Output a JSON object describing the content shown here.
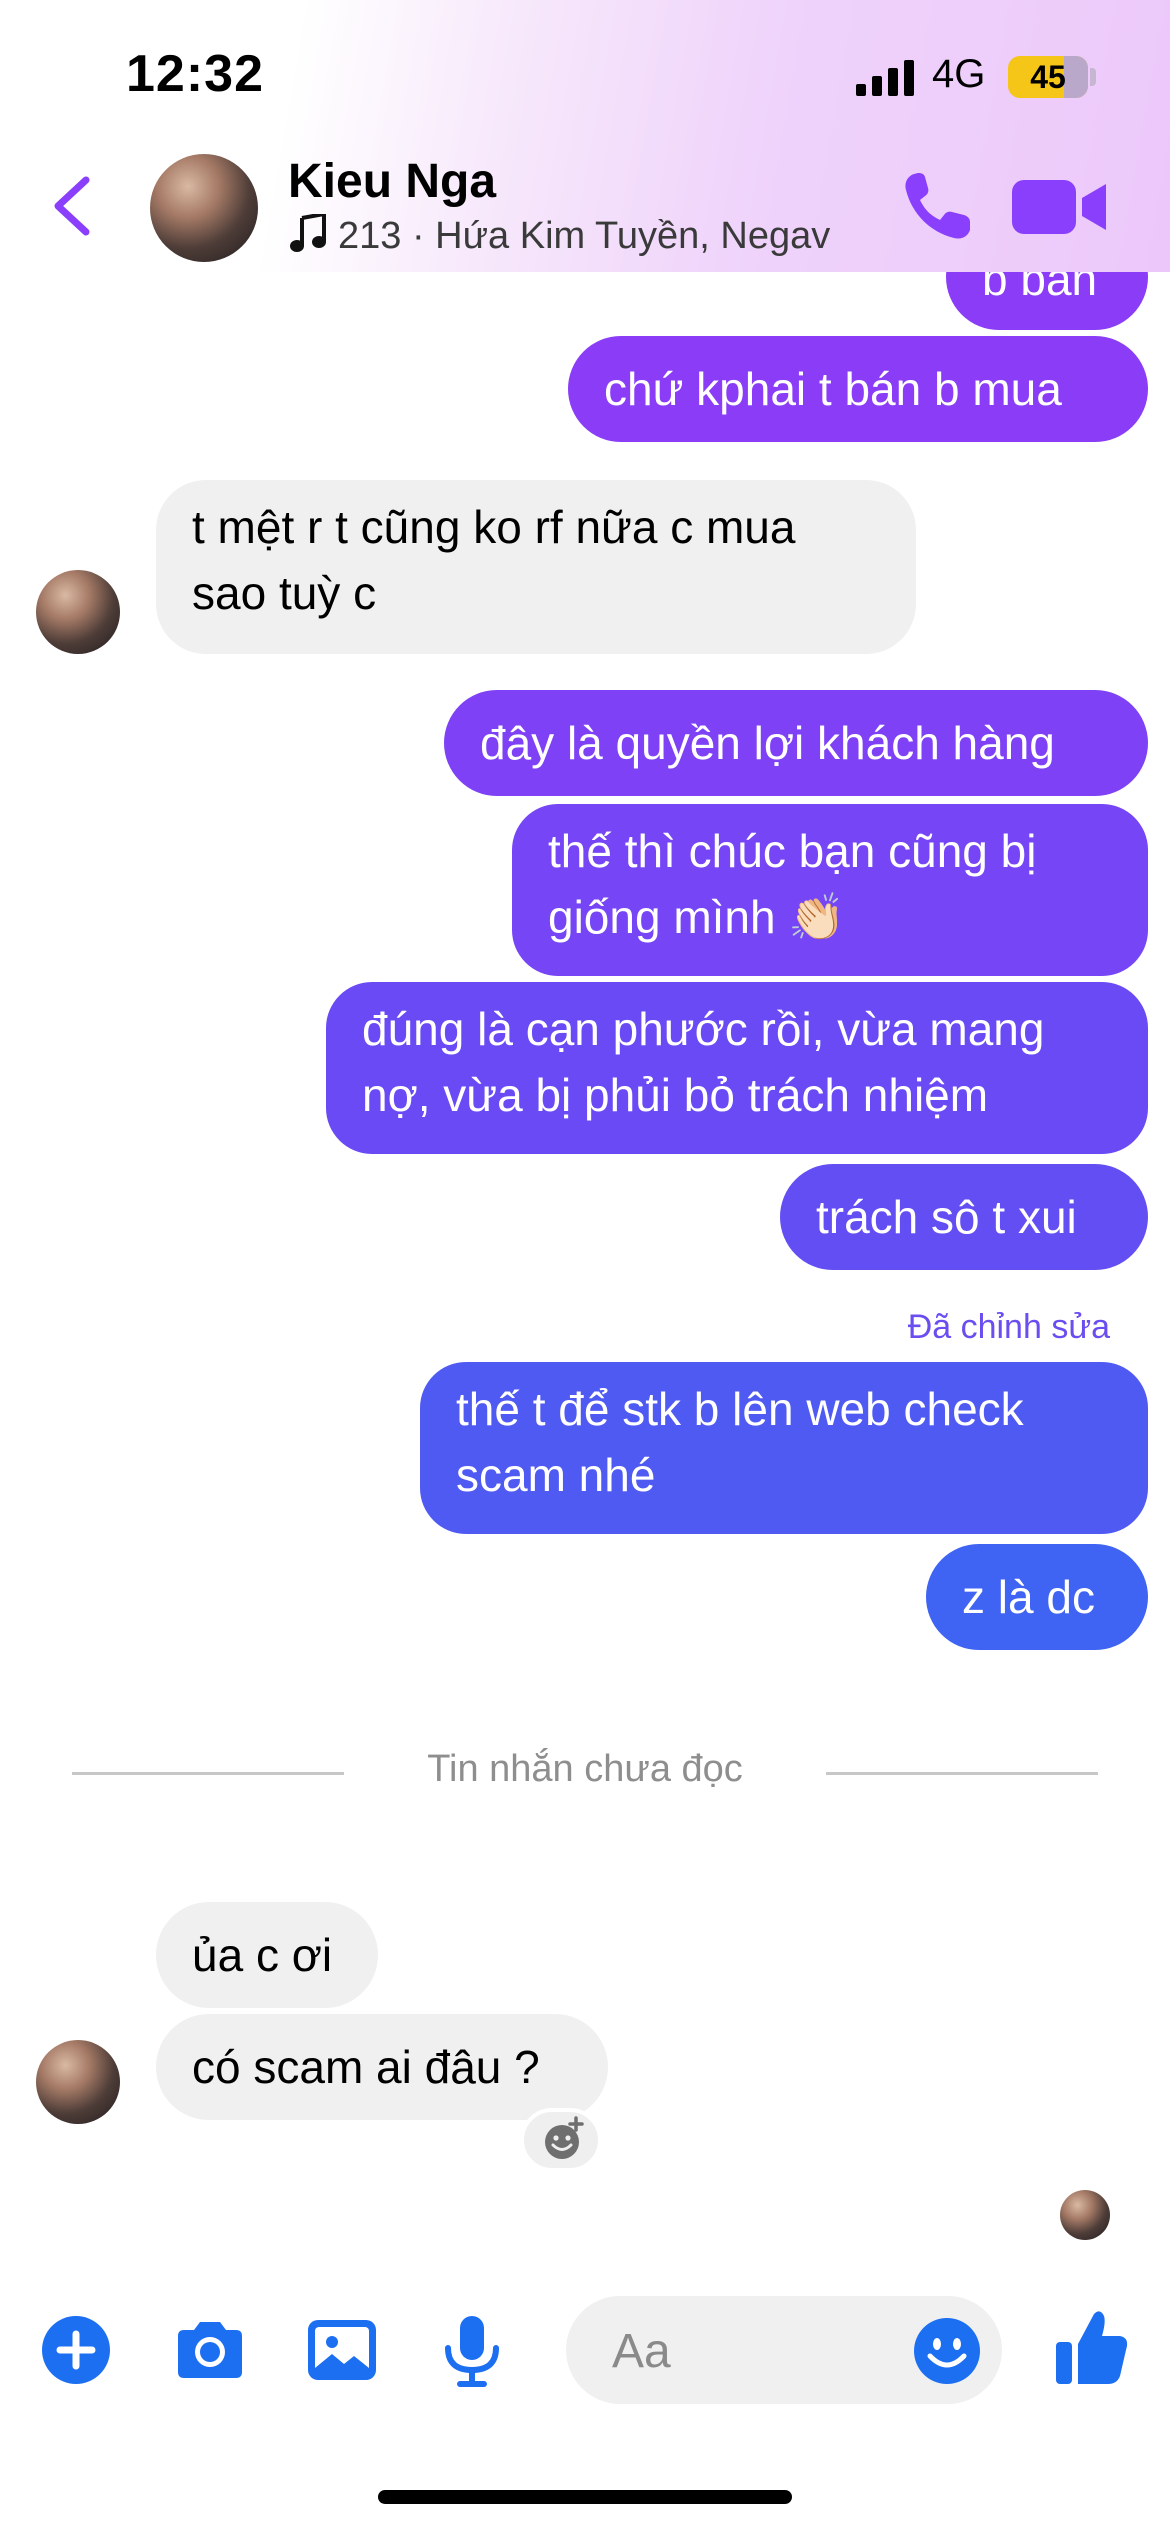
{
  "status_bar": {
    "time": "12:32",
    "network": "4G",
    "battery": "45"
  },
  "header": {
    "name": "Kieu Nga",
    "subtitle": "213 · Hứa Kim Tuyền, Negav"
  },
  "messages": [
    {
      "text": "b bán",
      "from": "me"
    },
    {
      "text": "chứ kphai t bán b mua",
      "from": "me"
    },
    {
      "lines": [
        "t mệt r t cũng ko rf nữa c mua",
        "sao tuỳ c"
      ],
      "from": "them"
    },
    {
      "text": "đây là quyền lợi khách hàng",
      "from": "me"
    },
    {
      "lines": [
        "thế thì chúc bạn cũng bị",
        "giống mình 👏🏻"
      ],
      "from": "me"
    },
    {
      "lines": [
        "đúng là cạn phước rồi, vừa mang",
        "nợ, vừa bị phủi bỏ trách nhiệm"
      ],
      "from": "me"
    },
    {
      "text": "trách sô t xui",
      "from": "me"
    },
    {
      "edited_label": "Đã chỉnh sửa",
      "lines": [
        "thế t để stk b lên web check",
        "scam nhé"
      ],
      "from": "me"
    },
    {
      "text": "z là dc",
      "from": "me"
    },
    {
      "text": "ủa c ơi",
      "from": "them"
    },
    {
      "text": "có scam ai đâu ?",
      "from": "them"
    }
  ],
  "unread_divider": "Tin nhắn chưa đọc",
  "composer": {
    "placeholder": "Aa"
  },
  "toolbar_icons": [
    "plus-icon",
    "camera-icon",
    "image-icon",
    "microphone-icon",
    "emoji-icon",
    "thumbs-up-icon"
  ],
  "colors": {
    "accent": "#8a3ffc",
    "bubble_top": "#8b3cf7",
    "bubble_bottom": "#3d63f2",
    "incoming": "#f0f0f0"
  }
}
